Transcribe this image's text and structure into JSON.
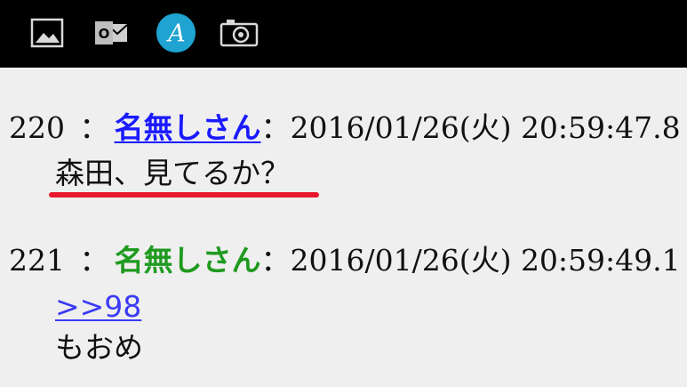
{
  "toolbar": {
    "icons": [
      {
        "name": "image-icon"
      },
      {
        "name": "outlook-icon",
        "label": "O"
      },
      {
        "name": "font-a-icon",
        "label": "A",
        "color": "#1fa3d1"
      },
      {
        "name": "camera-icon"
      }
    ]
  },
  "posts": [
    {
      "number": "220",
      "separator": "：",
      "name": "名無しさん",
      "name_color": "#1a1aff",
      "separator2": "：",
      "date": "2016/01/26(火) 20:59:47.8",
      "body": "森田、見てるか？",
      "highlight_color": "#e8192c"
    },
    {
      "number": "221",
      "separator": "：",
      "name": "名無しさん",
      "name_color": "#1f9a1f",
      "separator2": "：",
      "date": "2016/01/26(火) 20:59:49.1",
      "reply_link": ">>98",
      "body": "もおめ"
    }
  ]
}
